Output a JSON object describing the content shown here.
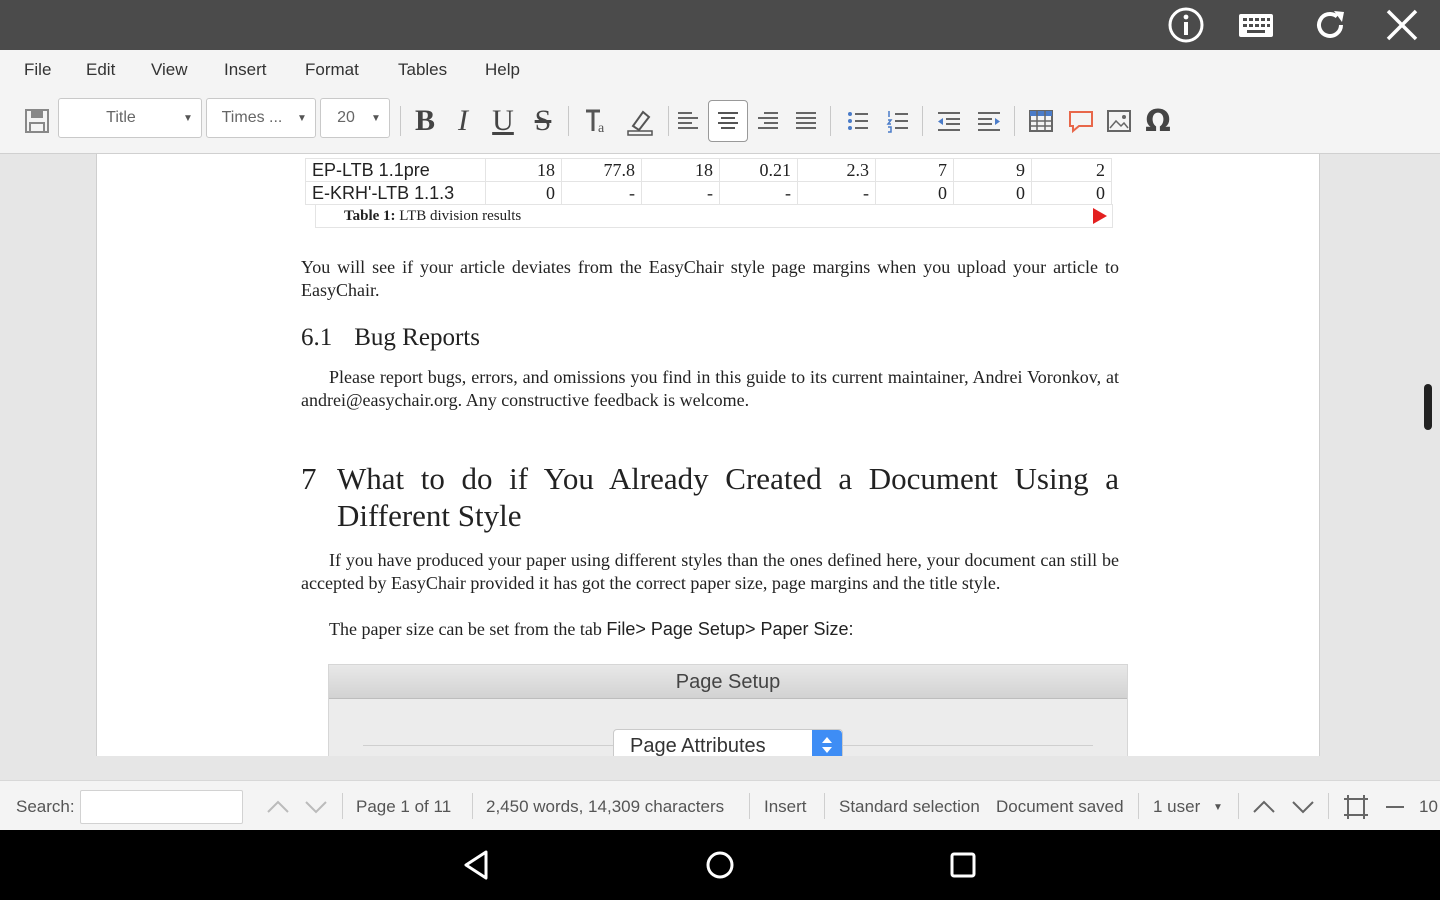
{
  "menu": [
    "File",
    "Edit",
    "View",
    "Insert",
    "Format",
    "Tables",
    "Help"
  ],
  "toolbar": {
    "style_combo": "Title",
    "font_combo": "Times ...",
    "size_combo": "20",
    "bold": "B",
    "italic": "I",
    "underline": "U",
    "strike": "S",
    "special_char": "Ω"
  },
  "document": {
    "table_rows": [
      [
        "EP-LTB 1.1pre",
        "18",
        "77.8",
        "18",
        "0.21",
        "2.3",
        "7",
        "9",
        "2"
      ],
      [
        "E-KRH'-LTB 1.1.3",
        "0",
        "-",
        "-",
        "-",
        "-",
        "0",
        "0",
        "0"
      ]
    ],
    "caption_label": "Table 1:",
    "caption_text": " LTB division results",
    "para1": "You will see if your article deviates from the EasyChair style page margins when you upload your article to EasyChair.",
    "h2_num": "6.1",
    "h2_text": "Bug Reports",
    "para2": "Please report bugs, errors, and omissions you find in this guide to its current maintainer, Andrei Voronkov, at andrei@easychair.org. Any constructive feedback is welcome.",
    "h1_num": "7",
    "h1_text": "What to do if You Already Created a Document Using a Different Style",
    "para3": "If you have produced your paper using different styles than the ones defined here, your document can still be accepted by EasyChair provided it has got the correct paper size, page margins and the title style.",
    "para4_lead": "The paper size can be set from the tab ",
    "para4_path": "File> Page Setup> Paper Size:",
    "dialog_title": "Page Setup",
    "dialog_select": "Page Attributes"
  },
  "status": {
    "search_label": "Search:",
    "page": "Page 1 of 11",
    "words": "2,450 words, 14,309 characters",
    "mode": "Insert",
    "selection": "Standard selection",
    "saved": "Document saved",
    "users": "1 user",
    "zoom": "10"
  }
}
